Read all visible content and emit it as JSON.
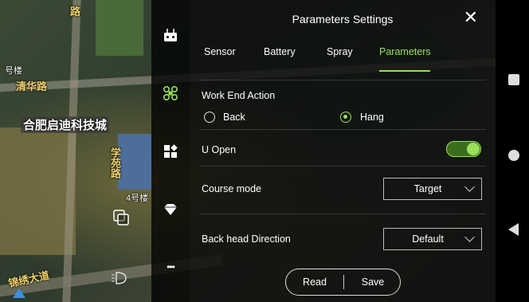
{
  "map": {
    "labels": [
      "号楼",
      "清华路",
      "合肥启迪科技城",
      "学苑路",
      "4号楼",
      "锦绣大道",
      "路"
    ]
  },
  "sidebar": {
    "icons": [
      "remote-controller-icon",
      "drone-icon",
      "apps-icon",
      "gem-icon",
      "more-icon"
    ],
    "more_label": "•••"
  },
  "panel": {
    "title": "Parameters Settings",
    "close_label": "✕",
    "tabs": [
      {
        "label": "Sensor"
      },
      {
        "label": "Battery"
      },
      {
        "label": "Spray"
      },
      {
        "label": "Parameters",
        "active": true
      }
    ],
    "work_end_action": {
      "label": "Work End Action",
      "options": [
        {
          "label": "Back",
          "checked": false
        },
        {
          "label": "Hang",
          "checked": true
        }
      ]
    },
    "u_open": {
      "label": "U Open",
      "enabled": true
    },
    "course_mode": {
      "label": "Course mode",
      "value": "Target"
    },
    "back_head_direction": {
      "label": "Back head Direction",
      "value": "Default"
    },
    "buttons": {
      "read": "Read",
      "save": "Save"
    }
  },
  "colors": {
    "accent": "#9be05a",
    "panel_bg": "#0a0a0a"
  }
}
